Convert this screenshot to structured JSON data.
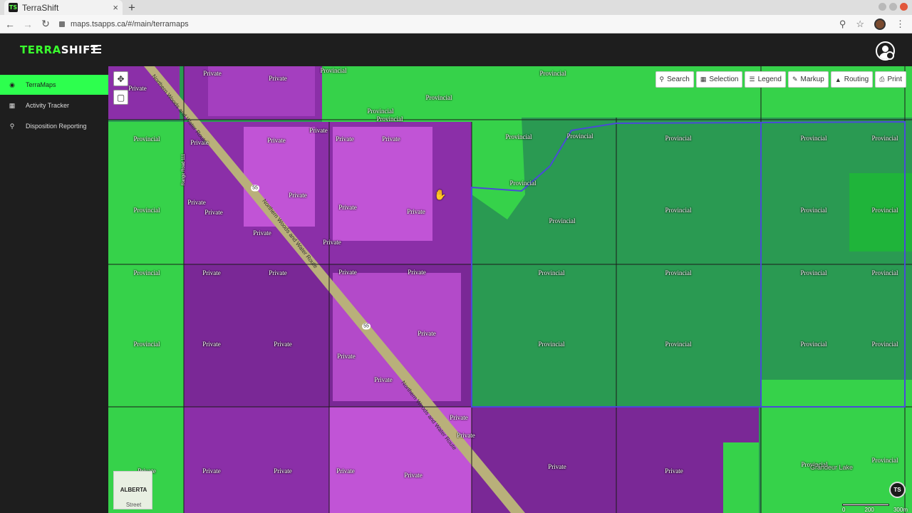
{
  "browser": {
    "tab_title": "TerraShift",
    "tab_close": "×",
    "new_tab": "+",
    "url": "maps.tsapps.ca/#/main/terramaps"
  },
  "app": {
    "logo_terra": "TERRA",
    "logo_shift": "SHIFT"
  },
  "sidebar": {
    "items": [
      {
        "label": "TerraMaps",
        "icon": "globe-icon",
        "active": true
      },
      {
        "label": "Activity Tracker",
        "icon": "bar-chart-icon",
        "active": false
      },
      {
        "label": "Disposition Reporting",
        "icon": "search-icon",
        "active": false
      }
    ]
  },
  "toolbar": {
    "search": "Search",
    "selection": "Selection",
    "legend": "Legend",
    "markup": "Markup",
    "routing": "Routing",
    "print": "Print"
  },
  "map": {
    "basemap_name": "ALBERTA",
    "basemap_style": "Street",
    "badge": "TS",
    "scale_labels": [
      "0",
      "200",
      "300m"
    ],
    "colors": {
      "private": "#8b2fa8",
      "private_light": "#c154d6",
      "provincial": "#36d24a",
      "provincial_dark": "#2a9a52",
      "road": "#b9b07a",
      "boundary": "#4a4ad8"
    },
    "parcel_labels": {
      "private": "Private",
      "provincial": "Provincial"
    },
    "road_name": "Northern Woods and Water Route",
    "highway_number": "55",
    "range_road": "Range Road 111",
    "lake_name": "Grandeur Lake"
  }
}
